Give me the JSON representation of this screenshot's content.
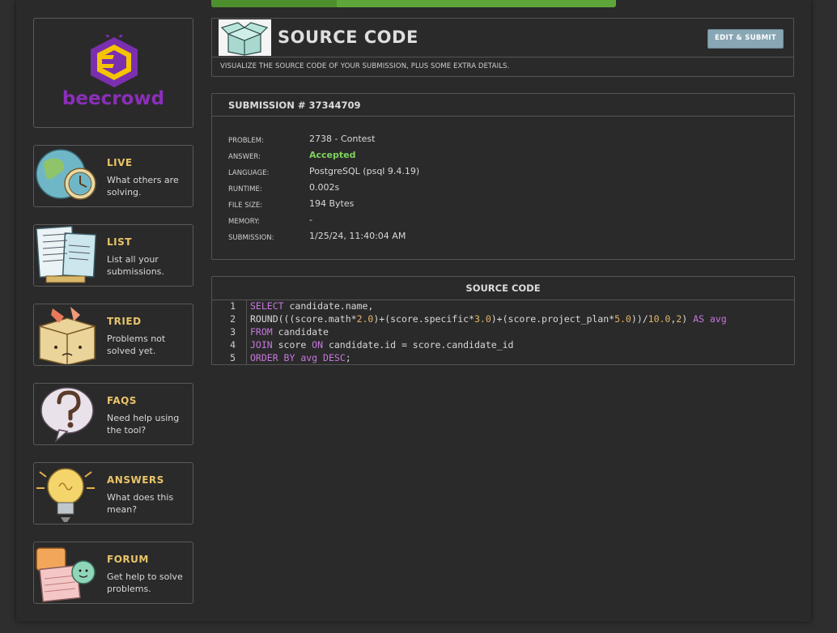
{
  "brand": {
    "name": "beecrowd",
    "color": "#8a2fb8"
  },
  "progress": {
    "fraction": 0.31,
    "color": "#5fa63a"
  },
  "nav": [
    {
      "title": "LIVE",
      "desc": "What others are solving.",
      "icon": "globe-clock-icon"
    },
    {
      "title": "LIST",
      "desc": "List all your submissions.",
      "icon": "paper-list-icon"
    },
    {
      "title": "TRIED",
      "desc": "Problems not solved yet.",
      "icon": "sad-box-icon"
    },
    {
      "title": "FAQS",
      "desc": "Need help using the tool?",
      "icon": "question-bubble-icon"
    },
    {
      "title": "ANSWERS",
      "desc": "What does this mean?",
      "icon": "lightbulb-icon"
    },
    {
      "title": "FORUM",
      "desc": "Get help to solve problems.",
      "icon": "chat-bubbles-icon"
    }
  ],
  "header": {
    "title": "SOURCE CODE",
    "subtitle": "VISUALIZE THE SOURCE CODE OF YOUR SUBMISSION, PLUS SOME EXTRA DETAILS.",
    "edit_label": "EDIT & SUBMIT",
    "icon": "open-box-icon"
  },
  "submission": {
    "heading": "SUBMISSION # 37344709",
    "fields": [
      {
        "label": "PROBLEM:",
        "value": "2738 - Contest"
      },
      {
        "label": "ANSWER:",
        "value": "Accepted"
      },
      {
        "label": "LANGUAGE:",
        "value": "PostgreSQL (psql 9.4.19)"
      },
      {
        "label": "RUNTIME:",
        "value": "0.002s"
      },
      {
        "label": "FILE SIZE:",
        "value": "194 Bytes"
      },
      {
        "label": "MEMORY:",
        "value": "-"
      },
      {
        "label": "SUBMISSION:",
        "value": "1/25/24, 11:40:04 AM"
      }
    ],
    "accepted_color": "#7dd45c"
  },
  "code": {
    "heading": "SOURCE CODE",
    "line_numbers": [
      "1",
      "2",
      "3",
      "4",
      "5"
    ],
    "lines": [
      [
        {
          "t": "SELECT",
          "k": "kw"
        },
        {
          "t": " candidate.name,"
        }
      ],
      [
        {
          "t": "ROUND((("
        },
        {
          "t": "score.math*"
        },
        {
          "t": "2.0",
          "k": "num"
        },
        {
          "t": ")+(score.specific*"
        },
        {
          "t": "3.0",
          "k": "num"
        },
        {
          "t": ")+(score.project_plan*"
        },
        {
          "t": "5.0",
          "k": "num"
        },
        {
          "t": "))/"
        },
        {
          "t": "10.0",
          "k": "num"
        },
        {
          "t": ","
        },
        {
          "t": "2",
          "k": "num"
        },
        {
          "t": ") "
        },
        {
          "t": "AS",
          "k": "kw"
        },
        {
          "t": " "
        },
        {
          "t": "avg",
          "k": "kw"
        }
      ],
      [
        {
          "t": "FROM",
          "k": "kw"
        },
        {
          "t": " candidate"
        }
      ],
      [
        {
          "t": "JOIN",
          "k": "kw"
        },
        {
          "t": " score "
        },
        {
          "t": "ON",
          "k": "kw"
        },
        {
          "t": " candidate.id = score.candidate_id"
        }
      ],
      [
        {
          "t": "ORDER BY",
          "k": "kw"
        },
        {
          "t": " "
        },
        {
          "t": "avg",
          "k": "kw"
        },
        {
          "t": " "
        },
        {
          "t": "DESC",
          "k": "kw"
        },
        {
          "t": ";"
        }
      ]
    ]
  }
}
